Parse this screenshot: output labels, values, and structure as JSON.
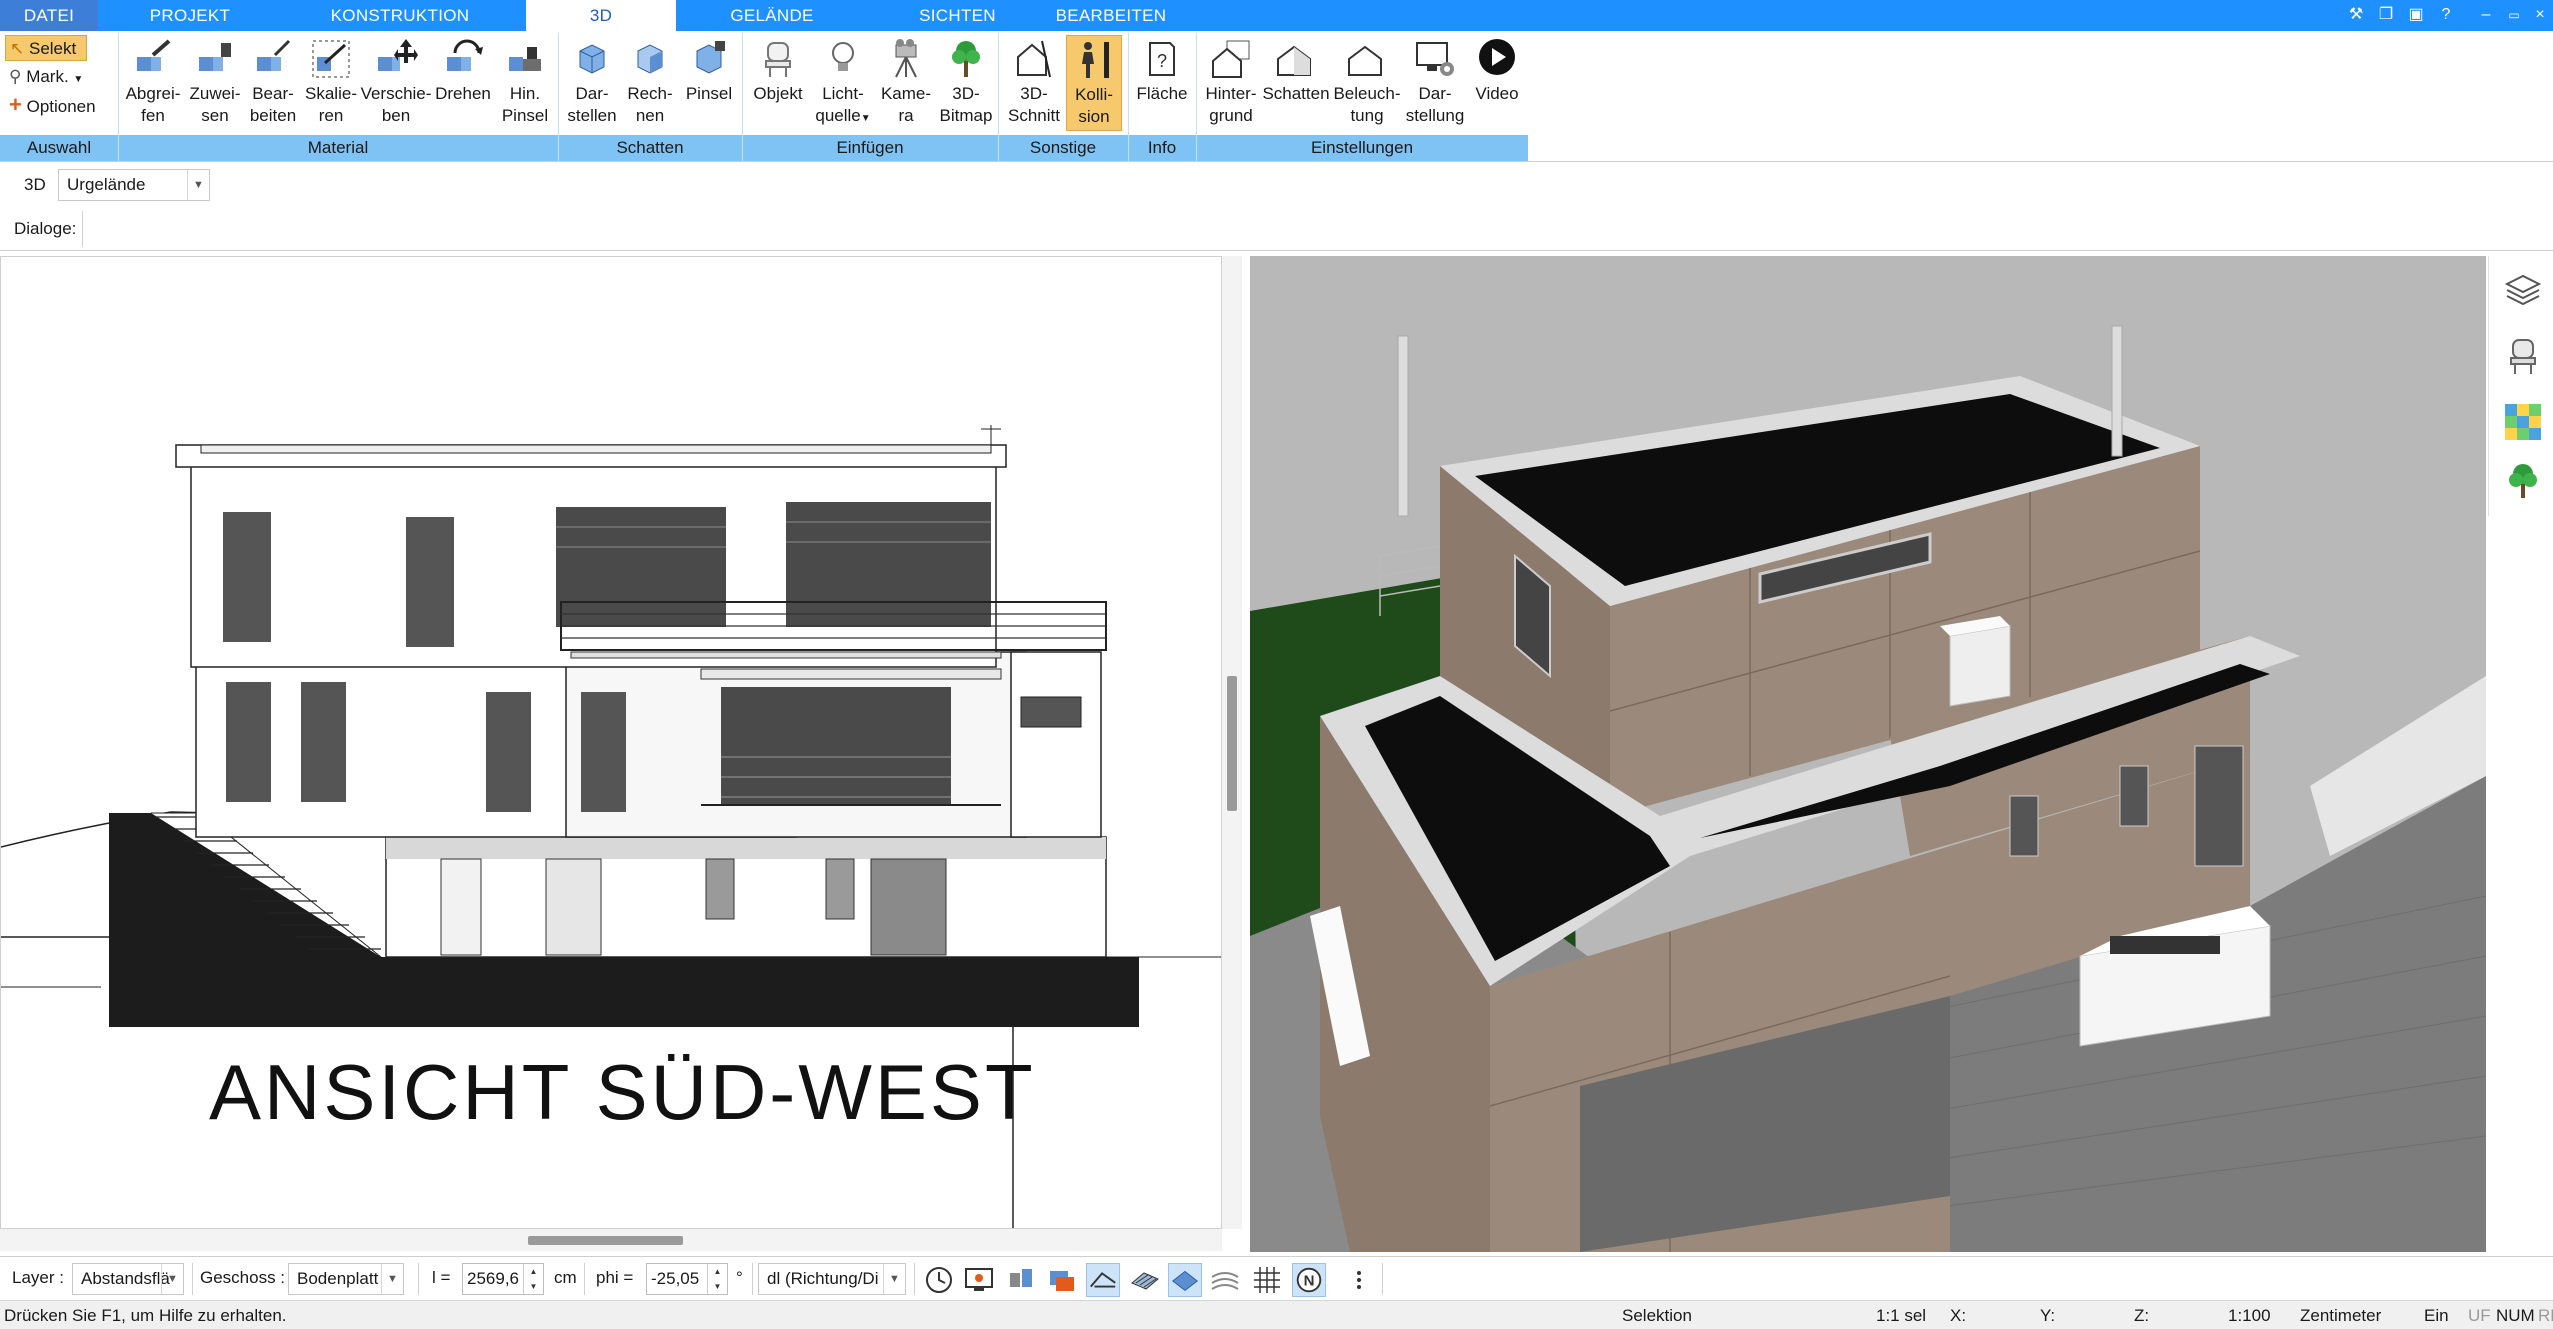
{
  "tabs": [
    {
      "label": "DATEI"
    },
    {
      "label": "PROJEKT"
    },
    {
      "label": "KONSTRUKTION"
    },
    {
      "label": "3D"
    },
    {
      "label": "GELÄNDE"
    },
    {
      "label": "SICHTEN"
    },
    {
      "label": "BEARBEITEN"
    }
  ],
  "active_tab": "3D",
  "selection": {
    "select_label": "Selekt",
    "mark_label": "Mark.",
    "options_label": "Optionen"
  },
  "groups": {
    "auswahl": "Auswahl",
    "material": "Material",
    "schatten": "Schatten",
    "einfuegen": "Einfügen",
    "sonstige": "Sonstige",
    "info": "Info",
    "einstellungen": "Einstellungen"
  },
  "ribbon_buttons": {
    "abgreifen": [
      "Abgrei-",
      "fen"
    ],
    "zuweisen": [
      "Zuwei-",
      "sen"
    ],
    "bearbeiten": [
      "Bear-",
      "beiten"
    ],
    "skalieren": [
      "Skalie-",
      "ren"
    ],
    "verschieben": [
      "Verschie-",
      "ben"
    ],
    "drehen": [
      "Drehen",
      ""
    ],
    "hin_pinsel": [
      "Hin.",
      "Pinsel"
    ],
    "darstellen": [
      "Dar-",
      "stellen"
    ],
    "rechnen": [
      "Rech-",
      "nen"
    ],
    "pinsel": [
      "Pinsel",
      ""
    ],
    "objekt": [
      "Objekt",
      ""
    ],
    "lichtquelle": [
      "Licht-",
      "quelle"
    ],
    "kamera": [
      "Kame-",
      "ra"
    ],
    "bitmap": [
      "3D-",
      "Bitmap"
    ],
    "schnitt": [
      "3D-",
      "Schnitt"
    ],
    "kollision": [
      "Kolli-",
      "sion"
    ],
    "flaeche": [
      "Fläche",
      ""
    ],
    "hintergrund": [
      "Hinter-",
      "grund"
    ],
    "schatten": [
      "Schatten",
      ""
    ],
    "beleuchtung": [
      "Beleuch-",
      "tung"
    ],
    "darstellung": [
      "Dar-",
      "stellung"
    ],
    "video": [
      "Video",
      ""
    ]
  },
  "view_selector": {
    "mode": "3D",
    "value": "Urgelände"
  },
  "dialoge_label": "Dialoge:",
  "plan_title": "ANSICHT SÜD-WEST",
  "bottom": {
    "layer_label": "Layer :",
    "layer_value": "Abstandsflä",
    "geschoss_label": "Geschoss :",
    "geschoss_value": "Bodenplatt",
    "l_label": "l =",
    "l_value": "2569,6",
    "l_unit": "cm",
    "phi_label": "phi =",
    "phi_value": "-25,05",
    "phi_unit": "°",
    "dl_value": "dl (Richtung/Di"
  },
  "status": {
    "help": "Drücken Sie F1, um Hilfe zu erhalten.",
    "mode": "Selektion",
    "scale_sel": "1:1 sel",
    "x": "X:",
    "y": "Y:",
    "z": "Z:",
    "scale": "1:100",
    "unit": "Zentimeter",
    "ein": "Ein",
    "uf": "UF",
    "num": "NUM",
    "rf": "RF"
  },
  "colors": {
    "tabbar": "#1e90ff",
    "group_strip": "#7fc3f5",
    "pressed": "#f7c96d",
    "facade": "#9b8a7b",
    "roof": "#0d0d0d",
    "grass": "#1f4a1a"
  }
}
